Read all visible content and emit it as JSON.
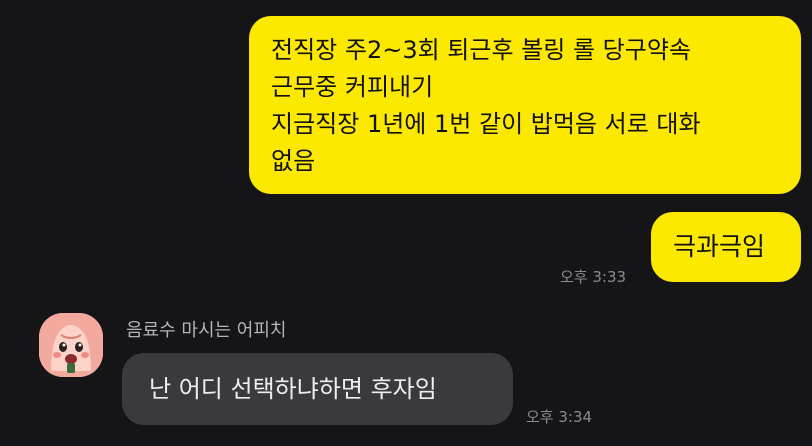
{
  "messages": {
    "outgoing_long": {
      "lines": [
        "전직장 주2~3회 퇴근후 볼링 롤 당구약속",
        "근무중 커피내기",
        "지금직장 1년에 1번 같이 밥먹음 서로 대화",
        "없음"
      ]
    },
    "outgoing_short": {
      "text": "극과극임",
      "time": "오후 3:33"
    },
    "incoming": {
      "sender": "음료수 마시는 어피치",
      "avatar_icon": "peach-character-icon",
      "text": "난 어디 선택하냐하면 후자임",
      "time": "오후 3:34"
    }
  },
  "colors": {
    "background": "#151517",
    "outgoing_bubble": "#fde800",
    "incoming_bubble": "#3a3a3e",
    "avatar": "#f4a99f"
  }
}
